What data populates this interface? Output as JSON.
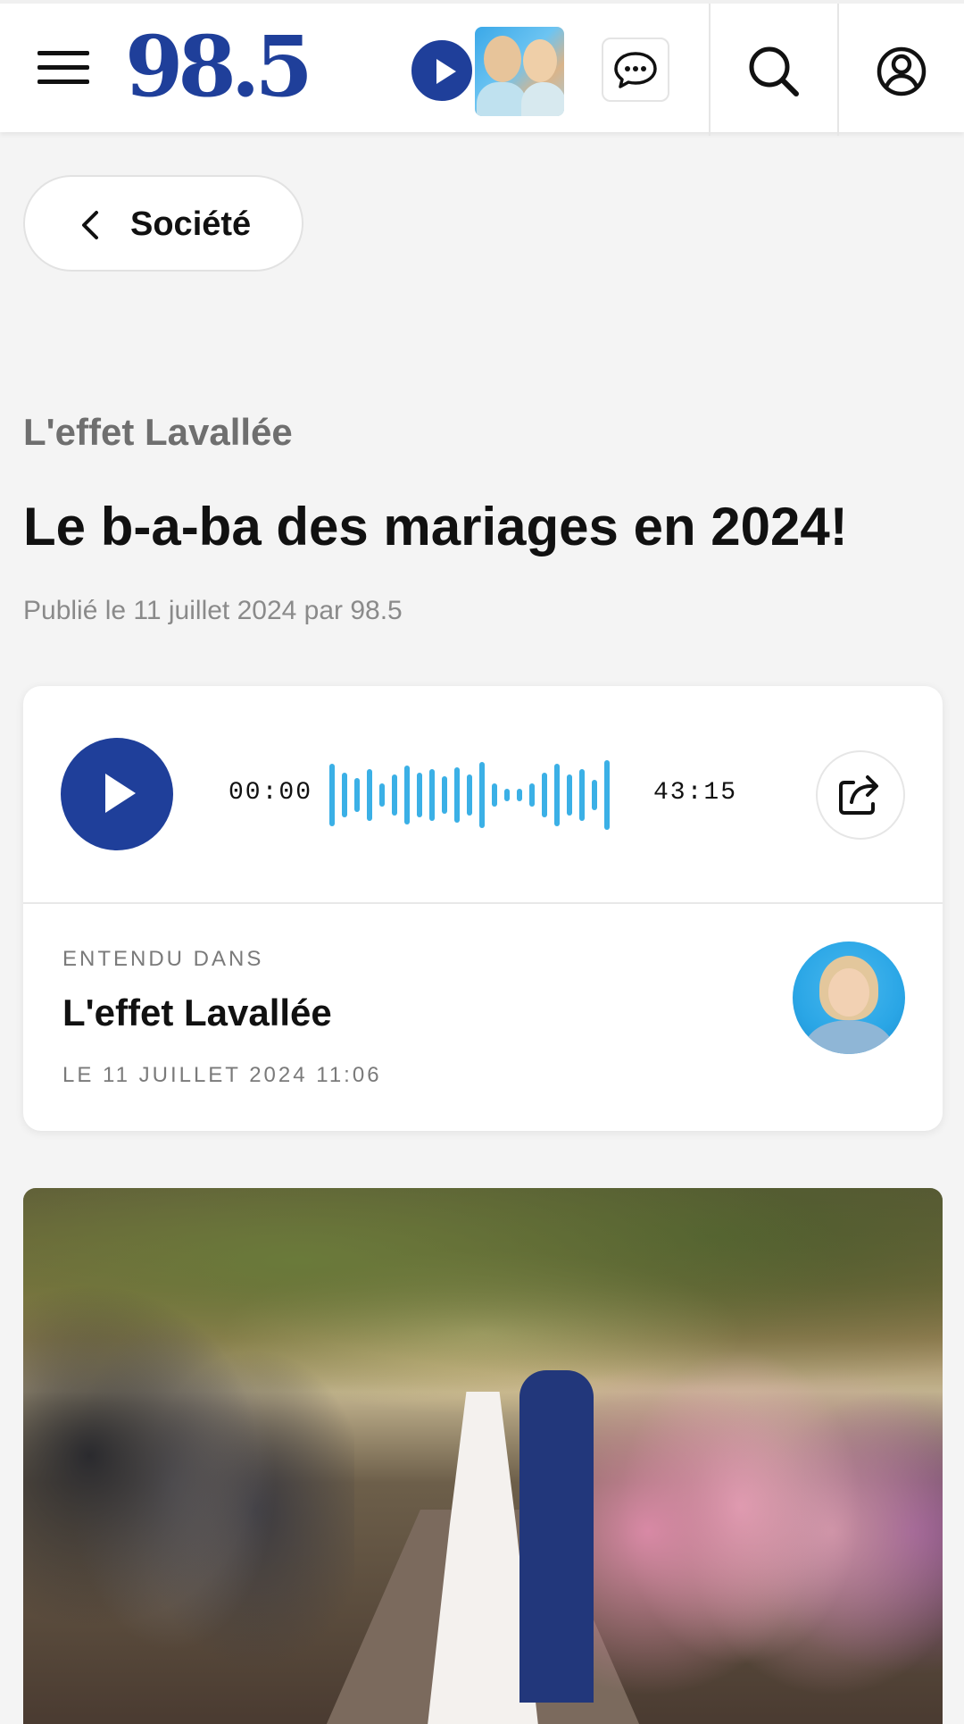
{
  "header": {
    "logo": "98.5",
    "colors": {
      "brand_blue": "#1f3f9a",
      "waveform": "#3bb0e6"
    },
    "icons": {
      "menu": "hamburger-menu-icon",
      "live_play": "play-icon",
      "chat": "chat-bubble-icon",
      "search": "search-icon",
      "account": "account-icon"
    }
  },
  "breadcrumb": {
    "back_label": "Société",
    "icon": "chevron-left-icon"
  },
  "article": {
    "show": "L'effet Lavallée",
    "title": "Le b-a-ba des mariages en 2024!",
    "byline": "Publié le 11 juillet 2024 par 98.5"
  },
  "audio_player": {
    "current_time": "00:00",
    "total_time": "43:15",
    "play_icon": "play-icon",
    "share_icon": "share-icon",
    "heard_in_label": "ENTENDU DANS",
    "show_name": "L'effet Lavallée",
    "aired": "LE 11 JUILLET 2024 11:06"
  }
}
